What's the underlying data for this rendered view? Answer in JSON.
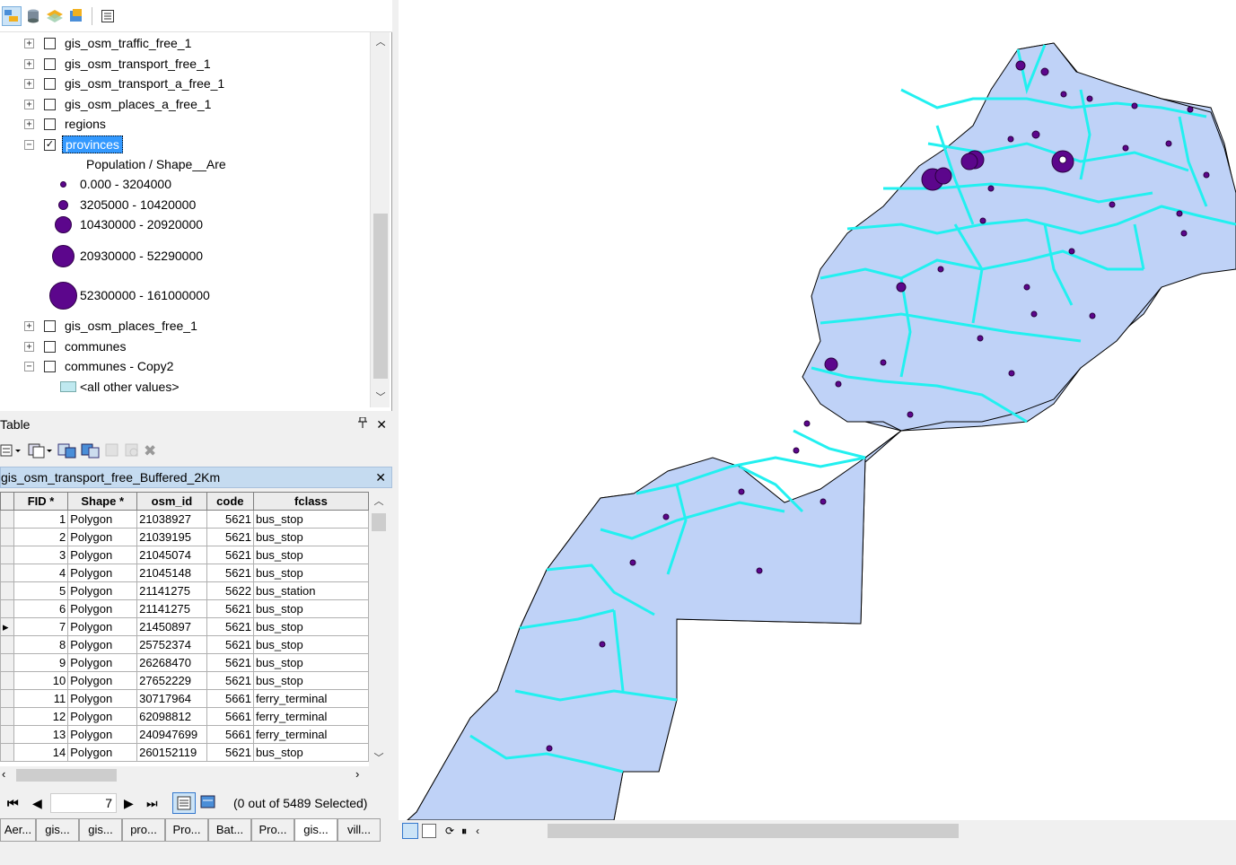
{
  "toc": {
    "toolbar_icons": [
      "list-by-drawing-order-icon",
      "list-by-source-icon",
      "list-by-visibility-icon",
      "list-by-selection-icon",
      "options-icon"
    ],
    "layers_top": [
      {
        "name": "gis_osm_traffic_free_1",
        "checked": false
      },
      {
        "name": "gis_osm_transport_free_1",
        "checked": false
      },
      {
        "name": "gis_osm_transport_a_free_1",
        "checked": false
      },
      {
        "name": "gis_osm_places_a_free_1",
        "checked": false
      },
      {
        "name": "regions",
        "checked": false
      },
      {
        "name": "provinces",
        "checked": true
      }
    ],
    "legend_heading": "Population / Shape__Are",
    "legend_classes": [
      "0.000 - 3204000",
      "3205000 - 10420000",
      "10430000 - 20920000",
      "20930000 - 52290000",
      "52300000 - 161000000"
    ],
    "layers_bottom": [
      {
        "name": "gis_osm_places_free_1",
        "checked": false
      },
      {
        "name": "communes",
        "checked": false
      },
      {
        "name": "communes - Copy2",
        "checked": false
      }
    ],
    "other_values": "<all other values>"
  },
  "table": {
    "title": "Table",
    "pin_glyph": "❘",
    "close_glyph": "✕",
    "tab_name": "gis_osm_transport_free_Buffered_2Km",
    "columns": [
      "FID *",
      "Shape *",
      "osm_id",
      "code",
      "fclass"
    ],
    "rows": [
      [
        "1",
        "Polygon",
        "21038927",
        "5621",
        "bus_stop"
      ],
      [
        "2",
        "Polygon",
        "21039195",
        "5621",
        "bus_stop"
      ],
      [
        "3",
        "Polygon",
        "21045074",
        "5621",
        "bus_stop"
      ],
      [
        "4",
        "Polygon",
        "21045148",
        "5621",
        "bus_stop"
      ],
      [
        "5",
        "Polygon",
        "21141275",
        "5622",
        "bus_station"
      ],
      [
        "6",
        "Polygon",
        "21141275",
        "5621",
        "bus_stop"
      ],
      [
        "7",
        "Polygon",
        "21450897",
        "5621",
        "bus_stop"
      ],
      [
        "8",
        "Polygon",
        "25752374",
        "5621",
        "bus_stop"
      ],
      [
        "9",
        "Polygon",
        "26268470",
        "5621",
        "bus_stop"
      ],
      [
        "10",
        "Polygon",
        "27652229",
        "5621",
        "bus_stop"
      ],
      [
        "11",
        "Polygon",
        "30717964",
        "5661",
        "ferry_terminal"
      ],
      [
        "12",
        "Polygon",
        "62098812",
        "5661",
        "ferry_terminal"
      ],
      [
        "13",
        "Polygon",
        "240947699",
        "5661",
        "ferry_terminal"
      ],
      [
        "14",
        "Polygon",
        "260152119",
        "5621",
        "bus_stop"
      ]
    ],
    "current_record": "7",
    "selection_status": "(0 out of 5489 Selected)"
  },
  "bottom_tabs": [
    "Aer...",
    "gis...",
    "gis...",
    "pro...",
    "Pro...",
    "Bat...",
    "Pro...",
    "gis...",
    "vill..."
  ],
  "active_bottom_tab": 7,
  "colors": {
    "province_fill": "#bfd2f7",
    "province_outline": "#22f0f0",
    "point_symbol": "#5c068c",
    "selection": "#3399ff"
  },
  "map_icons": [
    "layout-view-icon",
    "data-view-icon",
    "refresh-icon",
    "pause-icon",
    "scroll-left-icon"
  ]
}
